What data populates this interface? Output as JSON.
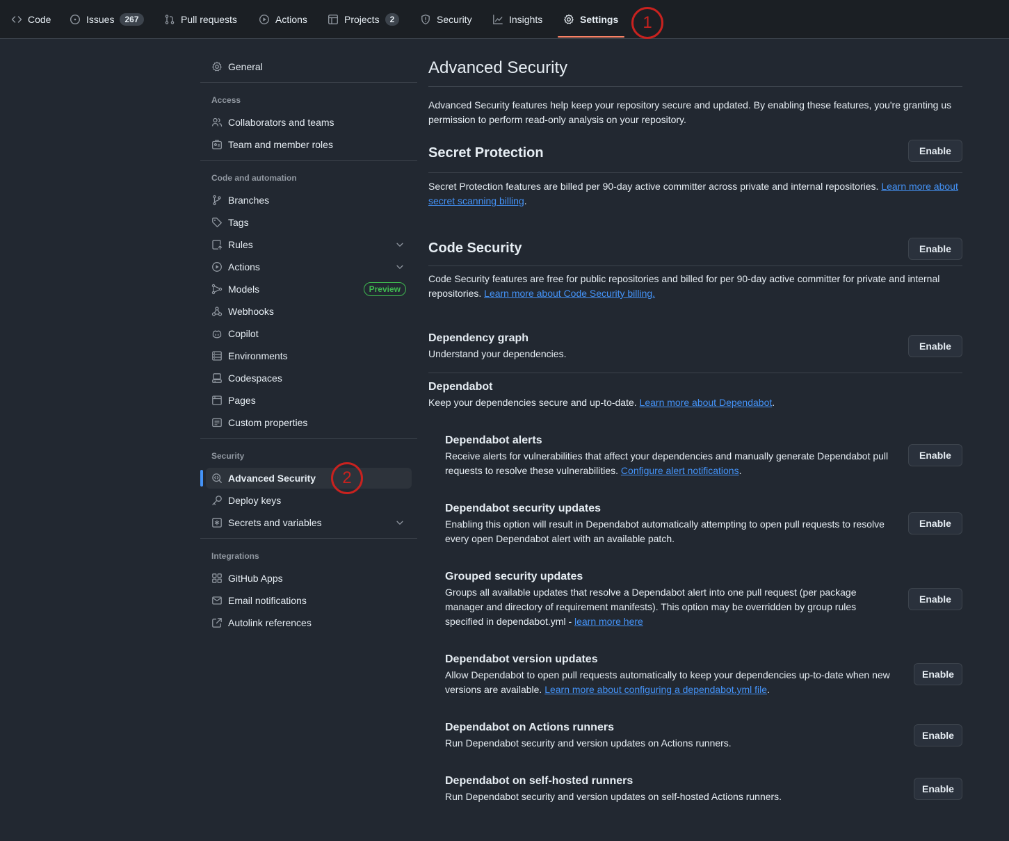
{
  "nav": {
    "tabs": [
      {
        "label": "Code",
        "icon": "code-icon"
      },
      {
        "label": "Issues",
        "icon": "issue-icon",
        "counter": "267"
      },
      {
        "label": "Pull requests",
        "icon": "pull-request-icon"
      },
      {
        "label": "Actions",
        "icon": "play-icon"
      },
      {
        "label": "Projects",
        "icon": "table-icon",
        "counter": "2"
      },
      {
        "label": "Security",
        "icon": "shield-icon"
      },
      {
        "label": "Insights",
        "icon": "graph-icon"
      },
      {
        "label": "Settings",
        "icon": "gear-icon",
        "active": true
      }
    ],
    "active_underline_color": "#f78166"
  },
  "markers": {
    "one": "1",
    "two": "2",
    "color": "#c8221f"
  },
  "sidebar": {
    "general": "General",
    "access_heading": "Access",
    "access": [
      "Collaborators and teams",
      "Team and member roles"
    ],
    "code_heading": "Code and automation",
    "code": [
      "Branches",
      "Tags",
      "Rules",
      "Actions",
      "Models",
      "Webhooks",
      "Copilot",
      "Environments",
      "Codespaces",
      "Pages",
      "Custom properties"
    ],
    "preview_badge": "Preview",
    "security_heading": "Security",
    "security": [
      "Advanced Security",
      "Deploy keys",
      "Secrets and variables"
    ],
    "integrations_heading": "Integrations",
    "integrations": [
      "GitHub Apps",
      "Email notifications",
      "Autolink references"
    ]
  },
  "main": {
    "title": "Advanced Security",
    "intro": "Advanced Security features help keep your repository secure and updated. By enabling these features, you're granting us permission to perform read-only analysis on your repository.",
    "enable_label": "Enable",
    "secret": {
      "title": "Secret Protection",
      "text": "Secret Protection features are billed per 90-day active committer across private and internal repositories. ",
      "link": "Learn more about secret scanning billing",
      "tail": "."
    },
    "code_security": {
      "title": "Code Security",
      "text": "Code Security features are free for public repositories and billed for per 90-day active committer for private and internal repositories. ",
      "link": "Learn more about Code Security billing."
    },
    "dependency_graph": {
      "title": "Dependency graph",
      "text": "Understand your dependencies."
    },
    "dependabot": {
      "title": "Dependabot",
      "text": "Keep your dependencies secure and up-to-date. ",
      "link": "Learn more about Dependabot",
      "tail": "."
    },
    "alerts": {
      "title": "Dependabot alerts",
      "text": "Receive alerts for vulnerabilities that affect your dependencies and manually generate Dependabot pull requests to resolve these vulnerabilities. ",
      "link": "Configure alert notifications",
      "tail": "."
    },
    "security_updates": {
      "title": "Dependabot security updates",
      "text": "Enabling this option will result in Dependabot automatically attempting to open pull requests to resolve every open Dependabot alert with an available patch."
    },
    "grouped": {
      "title": "Grouped security updates",
      "text": "Groups all available updates that resolve a Dependabot alert into one pull request (per package manager and directory of requirement manifests). This option may be overridden by group rules specified in dependabot.yml - ",
      "link": "learn more here"
    },
    "version_updates": {
      "title": "Dependabot version updates",
      "text": "Allow Dependabot to open pull requests automatically to keep your dependencies up-to-date when new versions are available. ",
      "link": "Learn more about configuring a dependabot.yml file",
      "tail": "."
    },
    "actions_runners": {
      "title": "Dependabot on Actions runners",
      "text": "Run Dependabot security and version updates on Actions runners."
    },
    "self_hosted": {
      "title": "Dependabot on self-hosted runners",
      "text": "Run Dependabot security and version updates on self-hosted Actions runners."
    }
  }
}
